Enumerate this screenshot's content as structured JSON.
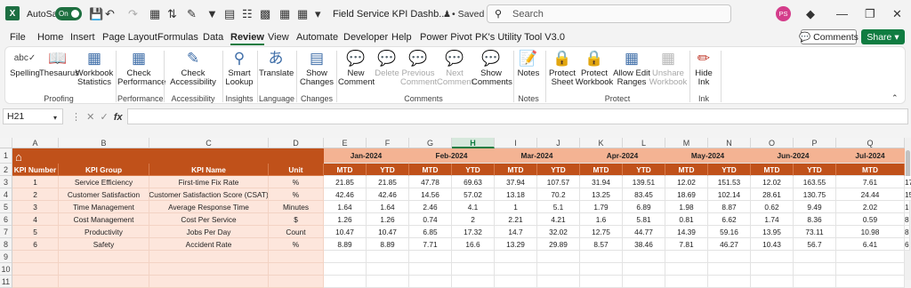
{
  "titlebar": {
    "autosave_label": "AutoSave",
    "toggle_label": "On",
    "doc_title": "Field Service KPI Dashb...",
    "saved_status": "• Saved",
    "search_placeholder": "Search",
    "avatar_initials": "PS"
  },
  "menu": {
    "tabs": [
      "File",
      "Home",
      "Insert",
      "Page Layout",
      "Formulas",
      "Data",
      "Review",
      "View",
      "Automate",
      "Developer",
      "Help",
      "Power Pivot",
      "PK's Utility Tool V3.0"
    ],
    "active": "Review",
    "comments_label": "Comments",
    "share_label": "Share"
  },
  "ribbon": {
    "spelling": "Spelling",
    "thesaurus": "Thesaurus",
    "workbook_statistics": "Workbook Statistics",
    "proofing": "Proofing",
    "check_performance": "Check Performance",
    "performance": "Performance",
    "check_accessibility": "Check Accessibility",
    "accessibility": "Accessibility",
    "smart_lookup": "Smart Lookup",
    "insights": "Insights",
    "translate": "Translate",
    "language": "Language",
    "show_changes": "Show Changes",
    "changes": "Changes",
    "new_comment": "New Comment",
    "delete": "Delete",
    "previous_comment": "Previous Comment",
    "next_comment": "Next Comment",
    "show_comments": "Show Comments",
    "comments_group": "Comments",
    "notes": "Notes",
    "notes_group": "Notes",
    "protect_sheet": "Protect Sheet",
    "protect_workbook": "Protect Workbook",
    "allow_edit_ranges": "Allow Edit Ranges",
    "unshare_workbook": "Unshare Workbook",
    "protect_group": "Protect",
    "hide_ink": "Hide Ink",
    "ink_group": "Ink"
  },
  "formula_bar": {
    "name_box": "H21",
    "fx": "fx",
    "formula": ""
  },
  "sheet": {
    "columns": [
      "A",
      "B",
      "C",
      "D",
      "E",
      "F",
      "G",
      "H",
      "I",
      "J",
      "K",
      "L",
      "M",
      "N",
      "O",
      "P",
      "Q"
    ],
    "selected_column": "H",
    "rows": [
      "1",
      "2",
      "3",
      "4",
      "5",
      "6",
      "7",
      "8",
      "9",
      "10",
      "11"
    ],
    "months": [
      "Jan-2024",
      "Feb-2024",
      "Mar-2024",
      "Apr-2024",
      "May-2024",
      "Jun-2024",
      "Jul-2024"
    ],
    "headers": {
      "kpi_number": "KPI Number",
      "kpi_group": "KPI Group",
      "kpi_name": "KPI Name",
      "unit": "Unit",
      "mtd": "MTD",
      "ytd": "YTD"
    },
    "kpis": [
      {
        "num": "1",
        "group": "Service Efficiency",
        "name": "First-time Fix Rate",
        "unit": "%",
        "values": [
          "21.85",
          "21.85",
          "47.78",
          "69.63",
          "37.94",
          "107.57",
          "31.94",
          "139.51",
          "12.02",
          "151.53",
          "12.02",
          "163.55",
          "7.61",
          "17"
        ]
      },
      {
        "num": "2",
        "group": "Customer Satisfaction",
        "name": "Customer Satisfaction Score (CSAT)",
        "unit": "%",
        "values": [
          "42.46",
          "42.46",
          "14.56",
          "57.02",
          "13.18",
          "70.2",
          "13.25",
          "83.45",
          "18.69",
          "102.14",
          "28.61",
          "130.75",
          "24.44",
          "15"
        ]
      },
      {
        "num": "3",
        "group": "Time Management",
        "name": "Average Response Time",
        "unit": "Minutes",
        "values": [
          "1.64",
          "1.64",
          "2.46",
          "4.1",
          "1",
          "5.1",
          "1.79",
          "6.89",
          "1.98",
          "8.87",
          "0.62",
          "9.49",
          "2.02",
          "1"
        ]
      },
      {
        "num": "4",
        "group": "Cost Management",
        "name": "Cost Per Service",
        "unit": "$",
        "values": [
          "1.26",
          "1.26",
          "0.74",
          "2",
          "2.21",
          "4.21",
          "1.6",
          "5.81",
          "0.81",
          "6.62",
          "1.74",
          "8.36",
          "0.59",
          "8"
        ]
      },
      {
        "num": "5",
        "group": "Productivity",
        "name": "Jobs Per Day",
        "unit": "Count",
        "values": [
          "10.47",
          "10.47",
          "6.85",
          "17.32",
          "14.7",
          "32.02",
          "12.75",
          "44.77",
          "14.39",
          "59.16",
          "13.95",
          "73.11",
          "10.98",
          "8"
        ]
      },
      {
        "num": "6",
        "group": "Safety",
        "name": "Accident Rate",
        "unit": "%",
        "values": [
          "8.89",
          "8.89",
          "7.71",
          "16.6",
          "13.29",
          "29.89",
          "8.57",
          "38.46",
          "7.81",
          "46.27",
          "10.43",
          "56.7",
          "6.41",
          "6"
        ]
      }
    ]
  }
}
